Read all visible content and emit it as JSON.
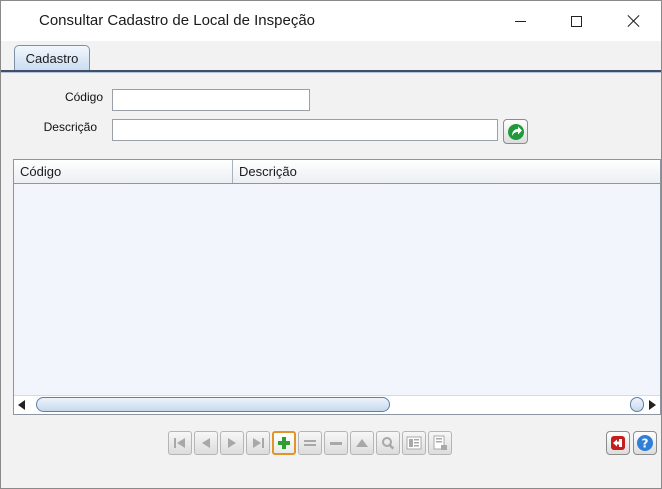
{
  "window": {
    "title": "Consultar Cadastro de Local de Inspeção"
  },
  "tabs": [
    {
      "label": "Cadastro",
      "active": true
    }
  ],
  "form": {
    "codigo_label": "Código",
    "codigo_value": "",
    "descricao_label": "Descrição",
    "descricao_value": ""
  },
  "grid": {
    "columns": [
      "Código",
      "Descrição"
    ],
    "rows": []
  },
  "navigator": {
    "buttons": [
      {
        "name": "first-record-icon",
        "enabled": false
      },
      {
        "name": "prior-record-icon",
        "enabled": false
      },
      {
        "name": "next-record-icon",
        "enabled": false
      },
      {
        "name": "last-record-icon",
        "enabled": false
      },
      {
        "name": "insert-record-icon",
        "enabled": true
      },
      {
        "name": "edit-record-icon",
        "enabled": false
      },
      {
        "name": "delete-record-icon",
        "enabled": false
      },
      {
        "name": "post-record-icon",
        "enabled": false
      },
      {
        "name": "search-record-icon",
        "enabled": false
      },
      {
        "name": "view-record-icon",
        "enabled": false
      },
      {
        "name": "export-record-icon",
        "enabled": false
      }
    ]
  },
  "colors": {
    "accent": "#e0952a",
    "insert_green": "#2e9e2e",
    "exit_red": "#c41e1e",
    "help_blue": "#2f7fd6",
    "go_green": "#1e9a3a"
  }
}
